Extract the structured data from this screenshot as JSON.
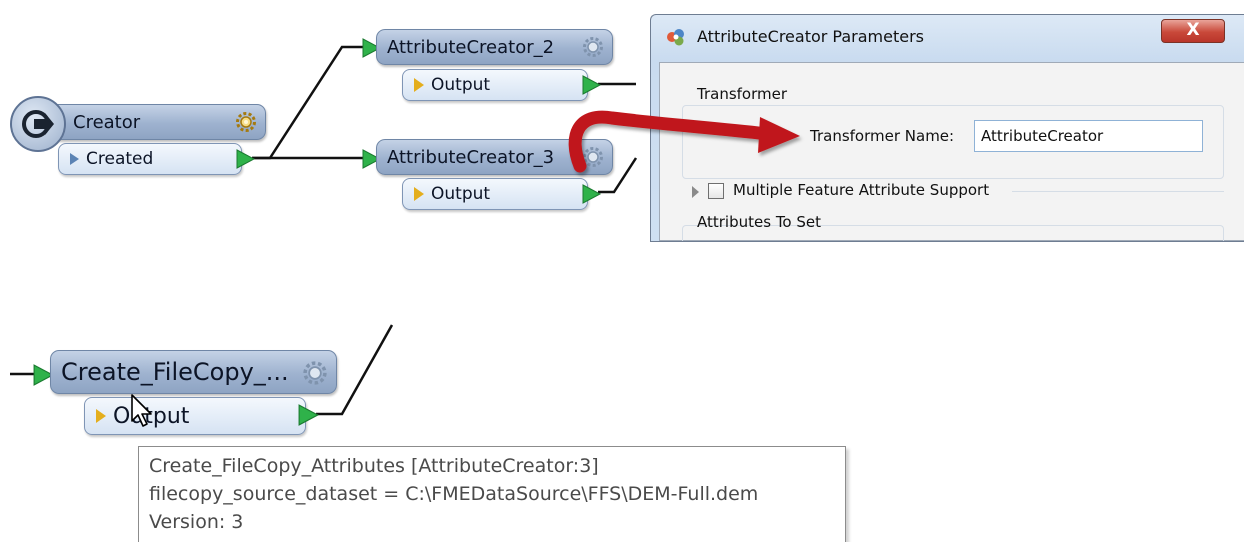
{
  "canvas": {
    "creator": {
      "title": "Creator",
      "port": "Created"
    },
    "attribute_creator_2": {
      "title": "AttributeCreator_2",
      "port": "Output"
    },
    "attribute_creator_3": {
      "title": "AttributeCreator_3",
      "port": "Output"
    },
    "create_filecopy": {
      "title": "Create_FileCopy_...",
      "port": "Output"
    }
  },
  "dialog": {
    "title": "AttributeCreator Parameters",
    "close_label": "X",
    "transformer_group_label": "Transformer",
    "transformer_name_label": "Transformer Name:",
    "transformer_name_value": "AttributeCreator",
    "multi_feature_label": "Multiple Feature Attribute Support",
    "multi_feature_checked": false,
    "attributes_group_label": "Attributes To Set"
  },
  "tooltip": {
    "line1": "Create_FileCopy_Attributes [AttributeCreator:3]",
    "line2": "filecopy_source_dataset = C:\\FMEDataSource\\FFS\\DEM-Full.dem",
    "line3": "Version: 3"
  },
  "colors": {
    "node_fill": "#9eb2cf",
    "port_fill": "#d6e3f3",
    "connector_green": "#2fb24a",
    "output_triangle": "#e4ae1d",
    "callout_arrow": "#c0181b",
    "close_button": "#c9493a"
  },
  "icons": {
    "gear": "gear-icon",
    "creator_badge": "creator-arrow-icon",
    "dialog_app": "fme-app-icon",
    "mouse_cursor": "mouse-pointer-icon"
  }
}
